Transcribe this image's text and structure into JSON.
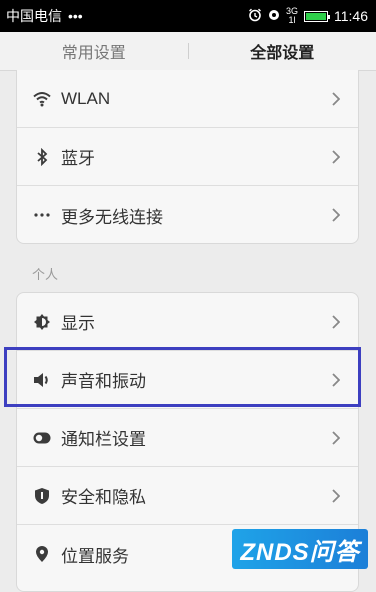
{
  "status_bar": {
    "carrier": "中国电信",
    "dots": "•••",
    "time": "11:46",
    "network_top": "3G",
    "network_bottom": "1l"
  },
  "tabs": [
    {
      "label": "常用设置",
      "active": false
    },
    {
      "label": "全部设置",
      "active": true
    }
  ],
  "wireless_group": [
    {
      "label": "WLAN",
      "icon": "wifi-icon"
    },
    {
      "label": "蓝牙",
      "icon": "bluetooth-icon"
    },
    {
      "label": "更多无线连接",
      "icon": "more-dots-icon"
    }
  ],
  "personal_section": {
    "label": "个人",
    "items": [
      {
        "label": "显示",
        "icon": "brightness-icon"
      },
      {
        "label": "声音和振动",
        "icon": "sound-icon"
      },
      {
        "label": "通知栏设置",
        "icon": "notification-toggle-icon"
      },
      {
        "label": "安全和隐私",
        "icon": "shield-icon"
      },
      {
        "label": "位置服务",
        "icon": "location-pin-icon"
      }
    ]
  },
  "watermark": "ZNDS问答",
  "colors": {
    "highlight_border": "#3d3fc0",
    "battery_fill": "#2fd04b",
    "watermark_bg": "#1fa3e8"
  }
}
